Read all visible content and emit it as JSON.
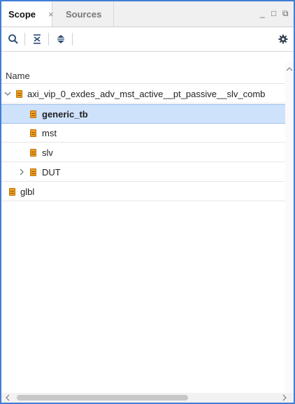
{
  "tabs": {
    "scope_label": "Scope",
    "scope_close": "×",
    "sources_label": "Sources"
  },
  "window_controls": {
    "minimize": "_",
    "maximize": "□",
    "float": "⧉"
  },
  "toolbar": {
    "icons": [
      "search-icon",
      "collapse-all-icon",
      "expand-all-icon",
      "gear-icon"
    ]
  },
  "tree": {
    "column_header": "Name",
    "items": [
      {
        "label": "axi_vip_0_exdes_adv_mst_active__pt_passive__slv_comb",
        "expanded": true,
        "level": 0,
        "selected": false,
        "bold": false
      },
      {
        "label": "generic_tb",
        "level": 1,
        "selected": true,
        "bold": true
      },
      {
        "label": "mst",
        "level": 1,
        "selected": false,
        "bold": false
      },
      {
        "label": "slv",
        "level": 1,
        "selected": false,
        "bold": false
      },
      {
        "label": "DUT",
        "expanded": false,
        "level": 1,
        "selected": false,
        "bold": false
      },
      {
        "label": "glbl",
        "level": 0,
        "selected": false,
        "bold": false
      }
    ]
  },
  "colors": {
    "accent_border": "#3f7ed5",
    "selection": "#cfe2fb",
    "module_icon": "#f0a020"
  }
}
